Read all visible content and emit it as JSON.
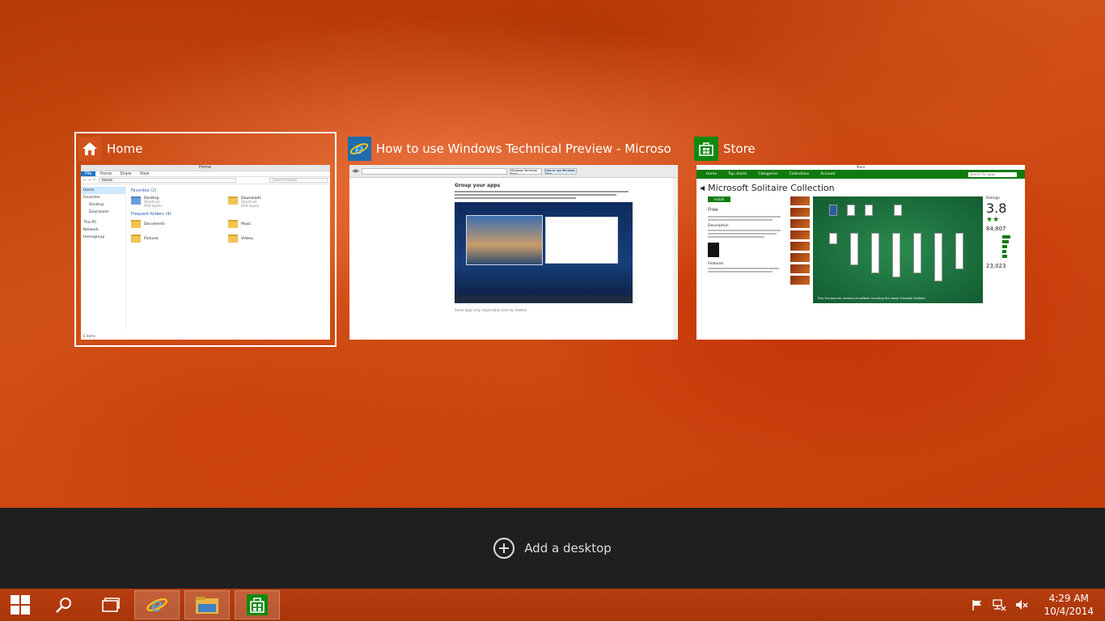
{
  "windows": [
    {
      "title": "Home",
      "icon": "home-icon"
    },
    {
      "title": "How to use Windows Technical Preview - Microso...",
      "icon": "internet-explorer-icon"
    },
    {
      "title": "Store",
      "icon": "store-icon"
    }
  ],
  "explorer": {
    "window_title": "Home",
    "ribbon": [
      "File",
      "Home",
      "Share",
      "View"
    ],
    "address": "Home",
    "search_placeholder": "Search Home",
    "nav": [
      "Home",
      "Favorites",
      "Desktop",
      "Downloads",
      "This PC",
      "Network",
      "Homegroup"
    ],
    "favorites_header": "Favorites (2)",
    "favorites": [
      {
        "name": "Desktop",
        "sub": "Shortcut",
        "size": "409 bytes"
      },
      {
        "name": "Downloads",
        "sub": "Shortcut",
        "size": "926 bytes"
      }
    ],
    "frequent_header": "Frequent folders (4)",
    "frequent": [
      "Documents",
      "Music",
      "Pictures",
      "Videos"
    ],
    "status": "6 items"
  },
  "ie": {
    "tab1": "Windows Technical Previ...",
    "tab2": "How to use Windows Tech...",
    "heading": "Group your apps",
    "caption": "Some apps only responsibly sizes by models."
  },
  "store": {
    "window_title": "Store",
    "nav": [
      "Home",
      "Top charts",
      "Categories",
      "Collections",
      "Account"
    ],
    "search_placeholder": "Search for apps",
    "app_title": "Microsoft Solitaire Collection",
    "install": "Install",
    "price": "Free",
    "rating_label": "Ratings",
    "rating_big": "3.8",
    "count": "84,807",
    "count2": "23,023",
    "game_caption": "Play five popular versions of solitaire including the classic Klondike Solitaire.",
    "description_label": "Description",
    "features_label": "Features"
  },
  "add_desktop": {
    "label": "Add a desktop"
  },
  "taskbar": {
    "time": "4:29 AM",
    "date": "10/4/2014"
  },
  "colors": {
    "accent": "#c8470d",
    "taskview_bar": "#1f1f1f",
    "store_green": "#0f7b0f"
  }
}
